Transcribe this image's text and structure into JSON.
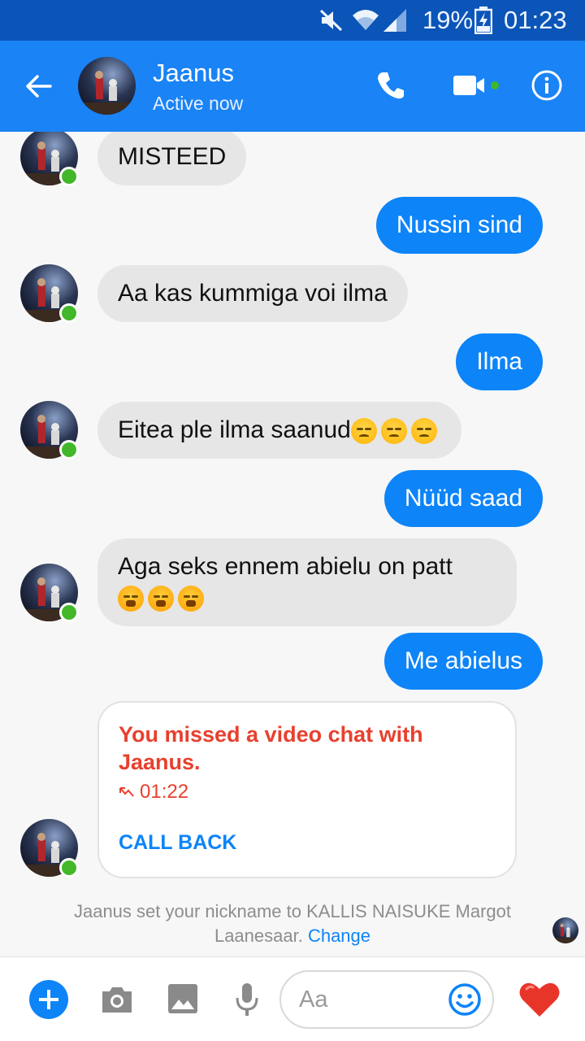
{
  "status_bar": {
    "battery": "19%",
    "time": "01:23",
    "icons": [
      "muted-icon",
      "wifi-icon",
      "signal-icon",
      "battery-charging-icon"
    ]
  },
  "header": {
    "name": "Jaanus",
    "status": "Active now",
    "icons": [
      "back-arrow-icon",
      "phone-icon",
      "video-camera-icon",
      "info-icon"
    ]
  },
  "messages": [
    {
      "from": "them",
      "text": "MISTEED"
    },
    {
      "from": "me",
      "text": "Nussin sind"
    },
    {
      "from": "them",
      "text": "Aa kas kummiga voi ilma"
    },
    {
      "from": "me",
      "text": "Ilma"
    },
    {
      "from": "them",
      "text": "Eitea ple ilma saanud",
      "emoji": [
        "disappointed-face",
        "disappointed-face",
        "disappointed-face"
      ]
    },
    {
      "from": "me",
      "text": "Nüüd saad"
    },
    {
      "from": "them",
      "text": "Aga seks ennem abielu on patt",
      "emoji": [
        "face-with-steam",
        "face-with-steam",
        "face-with-steam"
      ]
    },
    {
      "from": "me",
      "text": "Me abielus"
    }
  ],
  "missed_call": {
    "title": "You missed a video chat with Jaanus.",
    "time": "01:22",
    "action": "CALL BACK"
  },
  "notice": {
    "text": "Jaanus set your nickname to KALLIS NAISUKE Margot Laanesaar.",
    "link": "Change"
  },
  "composer": {
    "placeholder": "Aa",
    "icons": [
      "plus-icon",
      "camera-icon",
      "gallery-icon",
      "microphone-icon",
      "smiley-icon",
      "heart-icon"
    ]
  },
  "colors": {
    "accent": "#1a83f5",
    "status_bar": "#0b55b8",
    "outgoing_bubble": "#0d84f8",
    "incoming_bubble": "#e6e6e6",
    "missed": "#e8402e",
    "online": "#42b72a",
    "heart": "#e8352a"
  }
}
